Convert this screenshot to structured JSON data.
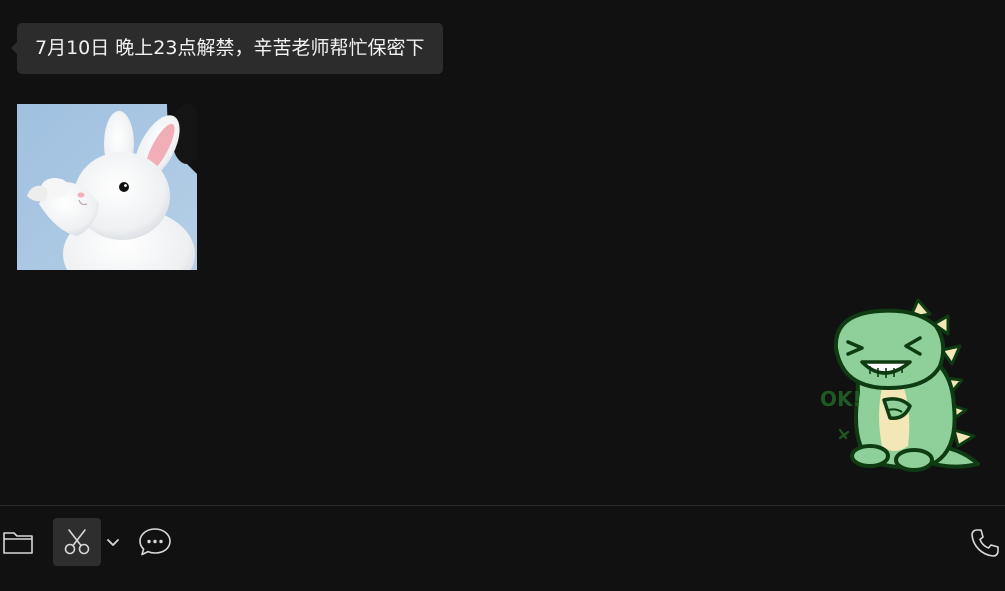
{
  "messages": [
    {
      "type": "text",
      "direction": "incoming",
      "text": "7月10日 晚上23点解禁，辛苦老师帮忙保密下"
    },
    {
      "type": "image",
      "direction": "incoming",
      "subject": "white rabbit saluting"
    },
    {
      "type": "sticker",
      "direction": "outgoing",
      "subject": "green dinosaur laughing",
      "sticker_text": "OK!"
    }
  ],
  "toolbar": {
    "icons": [
      "folder-icon",
      "scissors-icon",
      "chevron-down-icon",
      "chat-bubble-icon",
      "phone-icon"
    ]
  },
  "colors": {
    "background": "#111111",
    "bubble": "#2c2c2c",
    "bubble_text": "#f2f2f2",
    "icon": "#d8d8d8",
    "toolbar_active": "#2e2e2e",
    "dino_green": "#8fd09a",
    "dino_outline": "#0e3b12",
    "dino_belly": "#f3e7b8"
  }
}
